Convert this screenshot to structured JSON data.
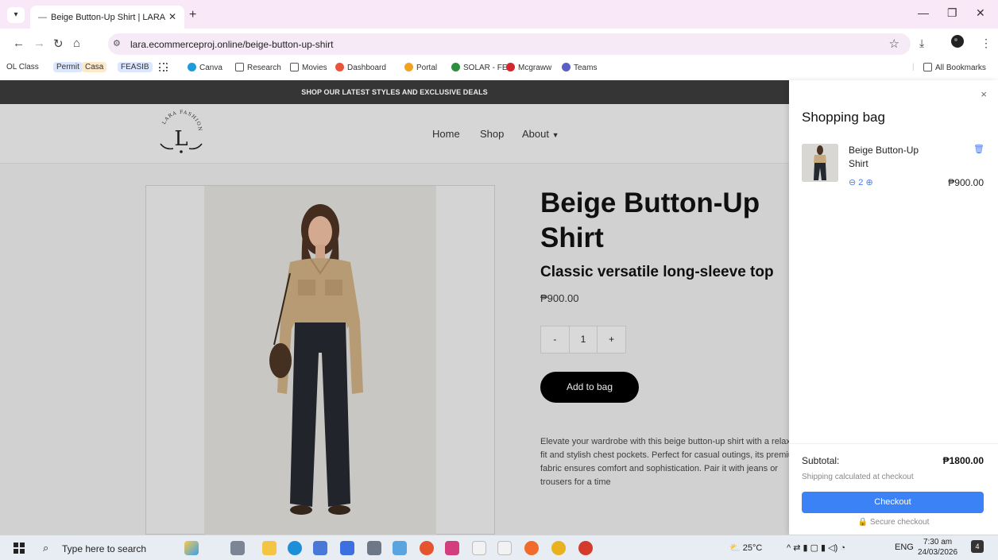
{
  "browser": {
    "tab_title": "Beige Button-Up Shirt | LARA",
    "url": "lara.ecommerceproj.online/beige-button-up-shirt",
    "bookmarks": [
      {
        "label": "OL Class",
        "style": "plain",
        "color": ""
      },
      {
        "label": "Permit",
        "style": "chip",
        "color": "#dbe6ff"
      },
      {
        "label": "Casa",
        "style": "chip",
        "color": "#fde9c8"
      },
      {
        "label": "FEASIB",
        "style": "chip",
        "color": "#dbe6ff"
      },
      {
        "label": "",
        "style": "grid",
        "color": "#555"
      },
      {
        "label": "Canva",
        "style": "icon",
        "color": "#1f9bd8"
      },
      {
        "label": "Research",
        "style": "folder",
        "color": ""
      },
      {
        "label": "Movies",
        "style": "folder",
        "color": ""
      },
      {
        "label": "Dashboard",
        "style": "icon",
        "color": "#e8553c"
      },
      {
        "label": "Portal",
        "style": "icon",
        "color": "#f2a21d"
      },
      {
        "label": "SOLAR - FEU",
        "style": "icon",
        "color": "#2f8d3e"
      },
      {
        "label": "Mcgraww",
        "style": "icon",
        "color": "#d4262c"
      },
      {
        "label": "Teams",
        "style": "icon",
        "color": "#5a5fc7"
      }
    ],
    "all_bookmarks": "All Bookmarks"
  },
  "site": {
    "promo": "SHOP OUR LATEST STYLES AND EXCLUSIVE DEALS",
    "logo_text": "LARA FASHION",
    "logo_letter": "L",
    "nav": [
      "Home",
      "Shop",
      "About"
    ],
    "product": {
      "title_line1": "Beige Button-Up",
      "title_line2": "Shirt",
      "subtitle": "Classic versatile long-sleeve top",
      "price": "₱900.00",
      "qty_minus": "-",
      "qty_value": "1",
      "qty_plus": "+",
      "add_to_bag": "Add to bag",
      "description": "Elevate your wardrobe with this beige button-up shirt with a relaxed fit and stylish chest pockets. Perfect for casual outings, its premium fabric ensures comfort and sophistication. Pair it with jeans or trousers for a time"
    }
  },
  "cart": {
    "title": "Shopping bag",
    "close": "×",
    "item": {
      "name": "Beige Button-Up Shirt",
      "qty": "2",
      "price": "₱900.00"
    },
    "subtotal_label": "Subtotal:",
    "subtotal_value": "₱1800.00",
    "shipping_note": "Shipping calculated at checkout",
    "checkout": "Checkout",
    "secure": "Secure checkout"
  },
  "taskbar": {
    "search_placeholder": "Type here to search",
    "weather": "25°C",
    "lang": "ENG",
    "time": "7:30 am",
    "date": "24/03/2026",
    "notif_count": "4"
  },
  "colors": {
    "accent": "#3b82f6",
    "chrome": "#f9e8f8",
    "promo": "#3a3a3a"
  }
}
